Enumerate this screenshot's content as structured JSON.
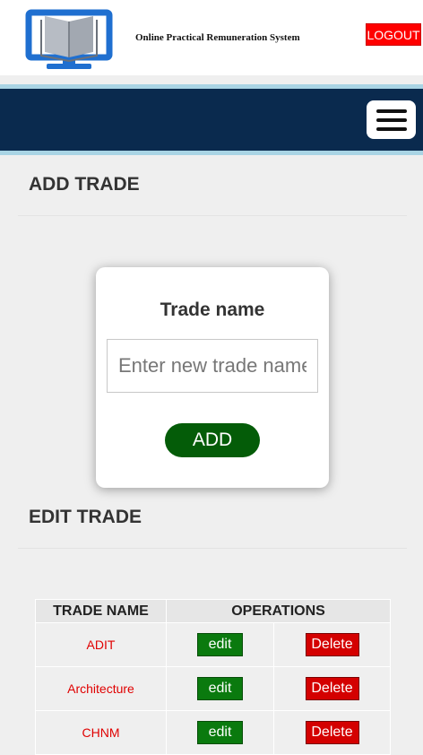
{
  "header": {
    "title": "Online Practical Remuneration System",
    "logout_label": "LOGOUT",
    "logo_icon": "monitor-book-icon"
  },
  "colors": {
    "navbar": "#0a2a4e",
    "accent_line": "#a9d4e4",
    "logout": "#ff0000",
    "add_button": "#045c08",
    "edit_button": "#0a7a0e",
    "delete_button": "#d40000",
    "trade_name_text": "#e00000"
  },
  "nav": {
    "menu_icon": "hamburger-menu-icon"
  },
  "add_section": {
    "title": "ADD TRADE",
    "field_label": "Trade name",
    "input_placeholder": "Enter new trade name",
    "input_value": "",
    "add_label": "ADD"
  },
  "edit_section": {
    "title": "EDIT TRADE",
    "columns": [
      "TRADE NAME",
      "OPERATIONS"
    ],
    "edit_label": "edit",
    "delete_label": "Delete",
    "rows": [
      {
        "name": "ADIT"
      },
      {
        "name": "Architecture"
      },
      {
        "name": "CHNM"
      }
    ]
  }
}
